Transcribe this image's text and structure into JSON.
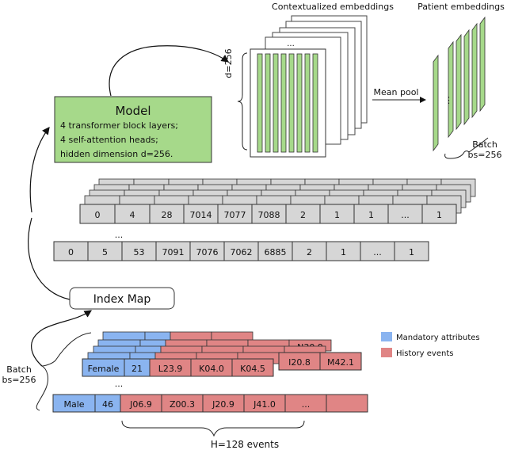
{
  "titles": {
    "contextualized": "Contextualized embeddings",
    "patient": "Patient embeddings"
  },
  "model": {
    "title": "Model",
    "lines": [
      "4 transformer block layers;",
      "4 self-attention heads;",
      "hidden dimension d=256."
    ]
  },
  "labels": {
    "d": "d=256",
    "mean_pool": "Mean pool",
    "batch_top": "Batch",
    "bs_top": "bs=256",
    "index_map": "Index Map",
    "batch_left": "Batch",
    "bs_left": "bs=256",
    "h_events": "H=128 events",
    "ellipsis": "...",
    "vdots": "⋮"
  },
  "legend": [
    {
      "label": "Mandatory attributes",
      "color": "#8ab4f0"
    },
    {
      "label": "History events",
      "color": "#e08585"
    }
  ],
  "colors": {
    "green": "#a6d98a",
    "gray": "#d6d6d6",
    "blue": "#8ab4f0",
    "red": "#e08585"
  },
  "index_rows": {
    "first": [
      "0",
      "4",
      "28",
      "7014",
      "7077",
      "7088",
      "2",
      "1",
      "1",
      "...",
      "1"
    ],
    "last": [
      "0",
      "5",
      "53",
      "7091",
      "7076",
      "7062",
      "6885",
      "2",
      "1",
      "...",
      "1"
    ]
  },
  "event_rows": {
    "first": [
      {
        "v": "Female",
        "k": "m"
      },
      {
        "v": "21",
        "k": "m"
      },
      {
        "v": "L23.9",
        "k": "h"
      },
      {
        "v": "K04.0",
        "k": "h"
      },
      {
        "v": "K04.5",
        "k": "h"
      }
    ],
    "first_behind": [
      "I20.8",
      "M42.1"
    ],
    "second_behind": [
      "N30.9"
    ],
    "last": [
      {
        "v": "Male",
        "k": "m"
      },
      {
        "v": "46",
        "k": "m"
      },
      {
        "v": "J06.9",
        "k": "h"
      },
      {
        "v": "Z00.3",
        "k": "h"
      },
      {
        "v": "J20.9",
        "k": "h"
      },
      {
        "v": "J41.0",
        "k": "h"
      },
      {
        "v": "...",
        "k": "h"
      },
      {
        "v": "",
        "k": "h"
      }
    ]
  }
}
